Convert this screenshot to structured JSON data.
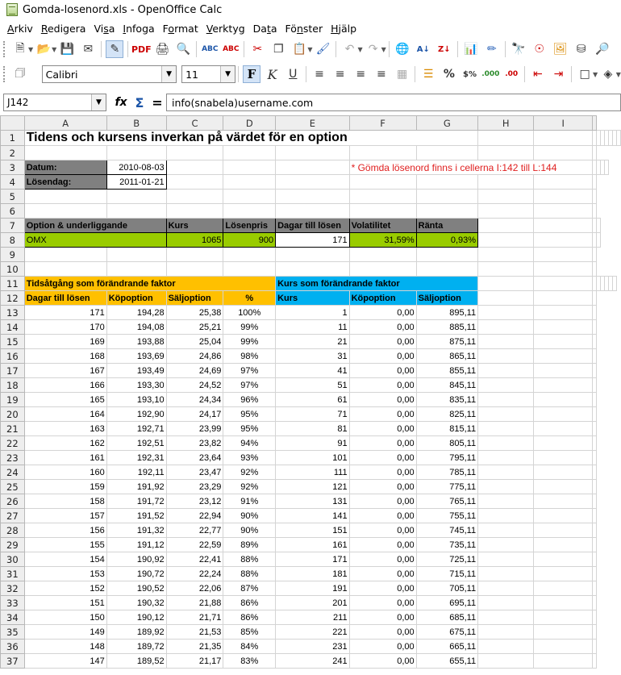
{
  "window": {
    "title": "Gomda-losenord.xls - OpenOffice Calc"
  },
  "menu": [
    "Arkiv",
    "Redigera",
    "Visa",
    "Infoga",
    "Format",
    "Verktyg",
    "Data",
    "Fönster",
    "Hjälp"
  ],
  "menu_underline": [
    "A",
    "R",
    "s",
    "I",
    "o",
    "V",
    "t",
    "n",
    "H"
  ],
  "format": {
    "font_name": "Calibri",
    "font_size": "11"
  },
  "formula_bar": {
    "cell_ref": "J142",
    "content": "info(snabela)username.com"
  },
  "columns": [
    "A",
    "B",
    "C",
    "D",
    "E",
    "F",
    "G",
    "H",
    "I"
  ],
  "sheet": {
    "title": "Tidens och kursens inverkan på värdet för en option",
    "datum_label": "Datum:",
    "datum_value": "2010-08-03",
    "losendag_label": "Lösendag:",
    "losendag_value": "2011-01-21",
    "note": "* Gömda lösenord finns i cellerna I:142 till L:144",
    "h7": {
      "a": "Option & underliggande",
      "c": "Kurs",
      "d": "Lösenpris",
      "e": "Dagar till lösen",
      "f": "Volatilitet",
      "g": "Ränta"
    },
    "r8": {
      "a": "OMX",
      "c": "1065",
      "d": "900",
      "e": "171",
      "f": "31,59%",
      "g": "0,93%"
    },
    "h11": {
      "left": "Tidsåtgång som förändrande faktor",
      "right": "Kurs som förändrande faktor"
    },
    "h12": {
      "a": "Dagar till lösen",
      "b": "Köpoption",
      "c": "Säljoption",
      "d": "%",
      "e": "Kurs",
      "f": "Köpoption",
      "g": "Säljoption"
    },
    "rows": [
      [
        "171",
        "194,28",
        "25,38",
        "100%",
        "1",
        "0,00",
        "895,11"
      ],
      [
        "170",
        "194,08",
        "25,21",
        "99%",
        "11",
        "0,00",
        "885,11"
      ],
      [
        "169",
        "193,88",
        "25,04",
        "99%",
        "21",
        "0,00",
        "875,11"
      ],
      [
        "168",
        "193,69",
        "24,86",
        "98%",
        "31",
        "0,00",
        "865,11"
      ],
      [
        "167",
        "193,49",
        "24,69",
        "97%",
        "41",
        "0,00",
        "855,11"
      ],
      [
        "166",
        "193,30",
        "24,52",
        "97%",
        "51",
        "0,00",
        "845,11"
      ],
      [
        "165",
        "193,10",
        "24,34",
        "96%",
        "61",
        "0,00",
        "835,11"
      ],
      [
        "164",
        "192,90",
        "24,17",
        "95%",
        "71",
        "0,00",
        "825,11"
      ],
      [
        "163",
        "192,71",
        "23,99",
        "95%",
        "81",
        "0,00",
        "815,11"
      ],
      [
        "162",
        "192,51",
        "23,82",
        "94%",
        "91",
        "0,00",
        "805,11"
      ],
      [
        "161",
        "192,31",
        "23,64",
        "93%",
        "101",
        "0,00",
        "795,11"
      ],
      [
        "160",
        "192,11",
        "23,47",
        "92%",
        "111",
        "0,00",
        "785,11"
      ],
      [
        "159",
        "191,92",
        "23,29",
        "92%",
        "121",
        "0,00",
        "775,11"
      ],
      [
        "158",
        "191,72",
        "23,12",
        "91%",
        "131",
        "0,00",
        "765,11"
      ],
      [
        "157",
        "191,52",
        "22,94",
        "90%",
        "141",
        "0,00",
        "755,11"
      ],
      [
        "156",
        "191,32",
        "22,77",
        "90%",
        "151",
        "0,00",
        "745,11"
      ],
      [
        "155",
        "191,12",
        "22,59",
        "89%",
        "161",
        "0,00",
        "735,11"
      ],
      [
        "154",
        "190,92",
        "22,41",
        "88%",
        "171",
        "0,00",
        "725,11"
      ],
      [
        "153",
        "190,72",
        "22,24",
        "88%",
        "181",
        "0,00",
        "715,11"
      ],
      [
        "152",
        "190,52",
        "22,06",
        "87%",
        "191",
        "0,00",
        "705,11"
      ],
      [
        "151",
        "190,32",
        "21,88",
        "86%",
        "201",
        "0,00",
        "695,11"
      ],
      [
        "150",
        "190,12",
        "21,71",
        "86%",
        "211",
        "0,00",
        "685,11"
      ],
      [
        "149",
        "189,92",
        "21,53",
        "85%",
        "221",
        "0,00",
        "675,11"
      ],
      [
        "148",
        "189,72",
        "21,35",
        "84%",
        "231",
        "0,00",
        "665,11"
      ],
      [
        "147",
        "189,52",
        "21,17",
        "83%",
        "241",
        "0,00",
        "655,11"
      ]
    ]
  },
  "colors": {
    "gray_header": "#808080",
    "green": "#99cc00",
    "orange": "#ffc000",
    "blue": "#00b0f0",
    "note_red": "#e02020"
  }
}
